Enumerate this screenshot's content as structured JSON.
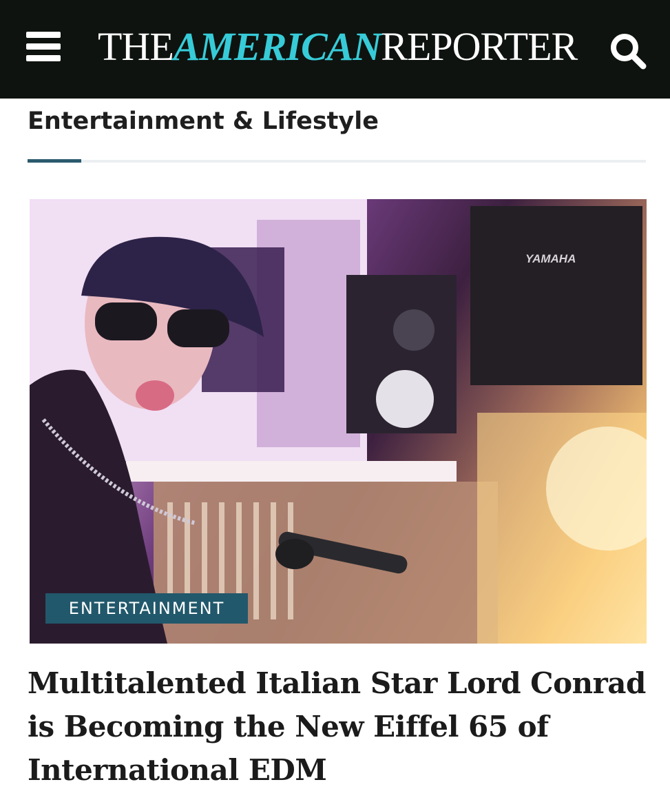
{
  "header": {
    "logo": {
      "part1": "THE",
      "part2": "AMERICAN",
      "part3": "REPORTER"
    },
    "menu_icon": "hamburger-menu-icon",
    "search_icon": "search-icon"
  },
  "section": {
    "title": "Entertainment & Lifestyle"
  },
  "article": {
    "image": {
      "speaker_brand": "YAMAHA"
    },
    "category_badge": "ENTERTAINMENT",
    "headline": "Multitalented Italian Star Lord Conrad is Becoming the New Eiffel 65 of International EDM"
  },
  "colors": {
    "header_bg": "#0e130f",
    "logo_accent": "#37cbd8",
    "badge_bg": "#22586b",
    "divider_accent": "#2a5a6e"
  }
}
